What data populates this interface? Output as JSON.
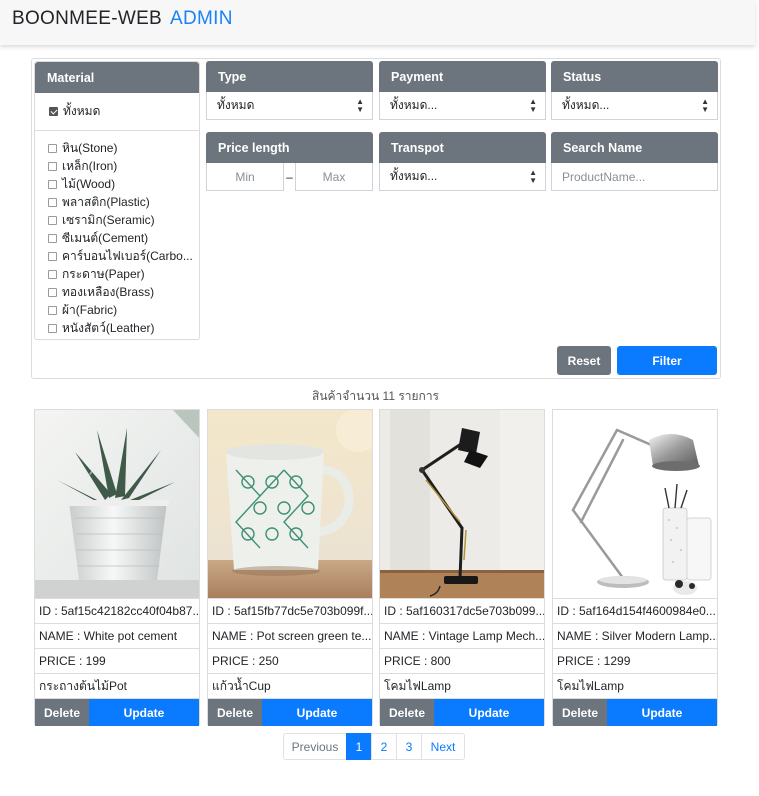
{
  "nav": {
    "brand_main": "BOONMEE-WEB",
    "brand_accent": "ADMIN"
  },
  "filters": {
    "material": {
      "title": "Material",
      "all_label": "ทั้งหมด",
      "all_checked": true,
      "items": [
        "หิน(Stone)",
        "เหล็ก(Iron)",
        "ไม้(Wood)",
        "พลาสติก(Plastic)",
        "เซรามิก(Seramic)",
        "ซีเมนต์(Cement)",
        "คาร์บอนไฟเบอร์(Carbo...",
        "กระดาษ(Paper)",
        "ทองเหลือง(Brass)",
        "ผ้า(Fabric)",
        "หนังสัตว์(Leather)"
      ]
    },
    "type": {
      "title": "Type",
      "value": "ทั้งหมด"
    },
    "payment": {
      "title": "Payment",
      "value": "ทั้งหมด..."
    },
    "status": {
      "title": "Status",
      "value": "ทั้งหมด..."
    },
    "price": {
      "title": "Price length",
      "min_placeholder": "Min",
      "max_placeholder": "Max",
      "separator": "–"
    },
    "transpot": {
      "title": "Transpot",
      "value": "ทั้งหมด..."
    },
    "search": {
      "title": "Search Name",
      "placeholder": "ProductName..."
    },
    "reset_label": "Reset",
    "filter_label": "Filter"
  },
  "result_count": "สินค้าจำนวน 11 รายการ",
  "products": [
    {
      "id": "ID : 5af15c42182cc40f04b87...",
      "name": "NAME : White pot cement",
      "price": "PRICE : 199",
      "category": "กระถางต้นไม้Pot",
      "image": "plant-pot-photo"
    },
    {
      "id": "ID : 5af15fb77dc5e703b099f...",
      "name": "NAME : Pot screen green te...",
      "price": "PRICE : 250",
      "category": "แก้วน้ำCup",
      "image": "mug-photo"
    },
    {
      "id": "ID : 5af160317dc5e703b099...",
      "name": "NAME : Vintage Lamp Mech...",
      "price": "PRICE : 800",
      "category": "โคมไฟLamp",
      "image": "vintage-lamp-photo"
    },
    {
      "id": "ID : 5af164d154f4600984e0...",
      "name": "NAME : Silver Modern Lamp...",
      "price": "PRICE : 1299",
      "category": "โคมไฟLamp",
      "image": "silver-lamp-photo"
    }
  ],
  "card_actions": {
    "delete": "Delete",
    "update": "Update"
  },
  "pagination": {
    "previous": "Previous",
    "pages": [
      "1",
      "2",
      "3"
    ],
    "active_page": "1",
    "next": "Next"
  },
  "colors": {
    "accent": "#0a7bff",
    "header_gray": "#6c757d",
    "brand_accent": "#1a82f5"
  }
}
